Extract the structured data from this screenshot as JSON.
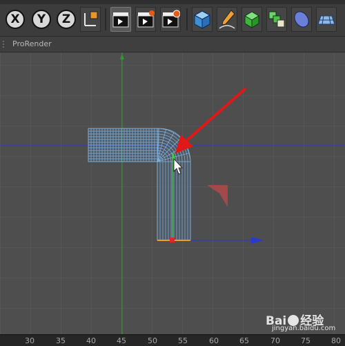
{
  "toolbar": {
    "axis_buttons": [
      {
        "label": "X"
      },
      {
        "label": "Y"
      },
      {
        "label": "Z"
      }
    ]
  },
  "menubar": {
    "items": [
      "ProRender"
    ]
  },
  "ruler": {
    "ticks": [
      "30",
      "35",
      "40",
      "45",
      "50",
      "55",
      "60",
      "65",
      "70",
      "75",
      "80"
    ]
  },
  "watermark": {
    "brand": "Bai",
    "brand2": "经验",
    "site": "jingyan.baidu.com"
  },
  "colors": {
    "mesh": "#7fb8e8",
    "y_axis": "#2f9a2f",
    "x_axis": "#2a3ad0",
    "arrow": "#e01818",
    "selection": "#37d437"
  }
}
